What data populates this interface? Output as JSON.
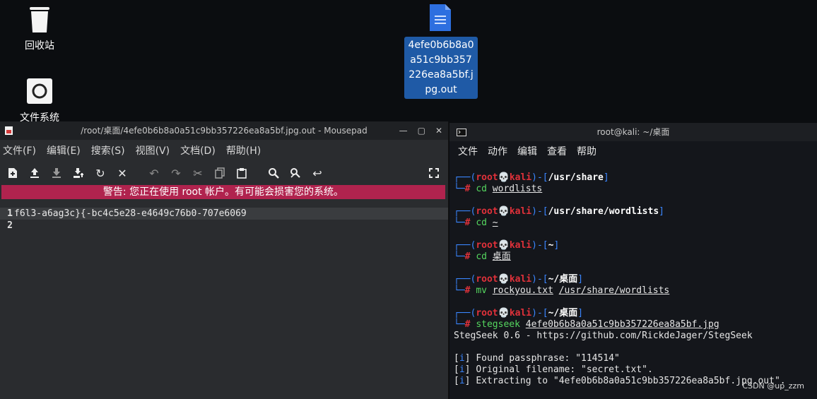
{
  "desktop": {
    "icons": [
      {
        "label": "回收站"
      },
      {
        "label": "文件系统"
      },
      {
        "label": "4efe0b6b8a0a51c9bb357226ea8a5bf.jpg.out"
      }
    ]
  },
  "mousepad": {
    "title": "/root/桌面/4efe0b6b8a0a51c9bb357226ea8a5bf.jpg.out - Mousepad",
    "menu": [
      "文件(F)",
      "编辑(E)",
      "搜索(S)",
      "视图(V)",
      "文档(D)",
      "帮助(H)"
    ],
    "warning": "警告: 您正在使用 root 帐户。有可能会损害您的系统。",
    "lines": [
      {
        "num": "1",
        "text": "f6l3-a6ag3c}{-bc4c5e28-e4649c76b0-707e6069"
      },
      {
        "num": "2",
        "text": ""
      }
    ]
  },
  "terminal": {
    "title": "root@kali: ~/桌面",
    "menu": [
      "文件",
      "动作",
      "编辑",
      "查看",
      "帮助"
    ],
    "user": "root",
    "host": "kali",
    "prompts": [
      {
        "dir": "/usr/share",
        "cmd": "cd",
        "arg": "wordlists",
        "arg2": ""
      },
      {
        "dir": "/usr/share/wordlists",
        "cmd": "cd",
        "arg": "~",
        "arg2": ""
      },
      {
        "dir": "~",
        "cmd": "cd",
        "arg": "桌面",
        "arg2": ""
      },
      {
        "dir": "~/桌面",
        "cmd": "mv",
        "arg": "rockyou.txt",
        "arg2": "/usr/share/wordlists"
      },
      {
        "dir": "~/桌面",
        "cmd": "stegseek",
        "arg": "4efe0b6b8a0a51c9bb357226ea8a5bf.jpg",
        "arg2": ""
      }
    ],
    "output": {
      "banner": "StegSeek 0.6 - https://github.com/RickdeJager/StegSeek",
      "info_tag": "i",
      "found": "Found passphrase: \"114514\"",
      "original": "Original filename: \"secret.txt\".",
      "extracting": "Extracting to \"4efe0b6b8a0a51c9bb357226ea8a5bf.jpg.out\"."
    }
  },
  "watermark": "CSDN @up_zzm"
}
